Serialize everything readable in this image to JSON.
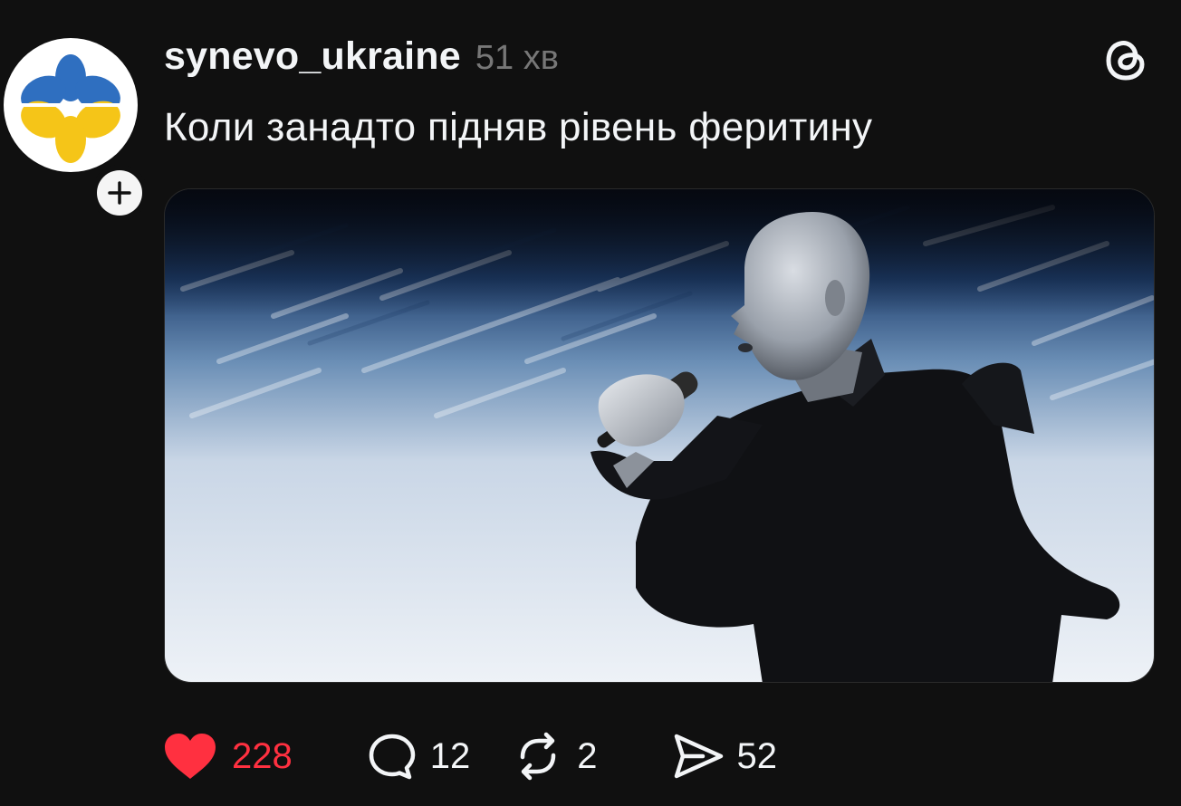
{
  "post": {
    "username": "synevo_ukraine",
    "timestamp": "51 хв",
    "caption": "Коли занадто підняв рівень феритину",
    "media_alt": "image"
  },
  "actions": {
    "likes": "228",
    "replies": "12",
    "reposts": "2",
    "shares": "52",
    "liked": true
  },
  "icons": {
    "avatar": "synevo-logo-icon",
    "follow": "plus-icon",
    "brand": "threads-logo-icon",
    "like": "heart-icon",
    "reply": "speech-bubble-icon",
    "repost": "repost-icon",
    "share": "send-icon"
  },
  "colors": {
    "background": "#101010",
    "like_active": "#ff3040",
    "text_primary": "#f3f5f7",
    "text_secondary": "#777777",
    "logo_blue": "#2f6fc0",
    "logo_yellow": "#f5c518"
  }
}
